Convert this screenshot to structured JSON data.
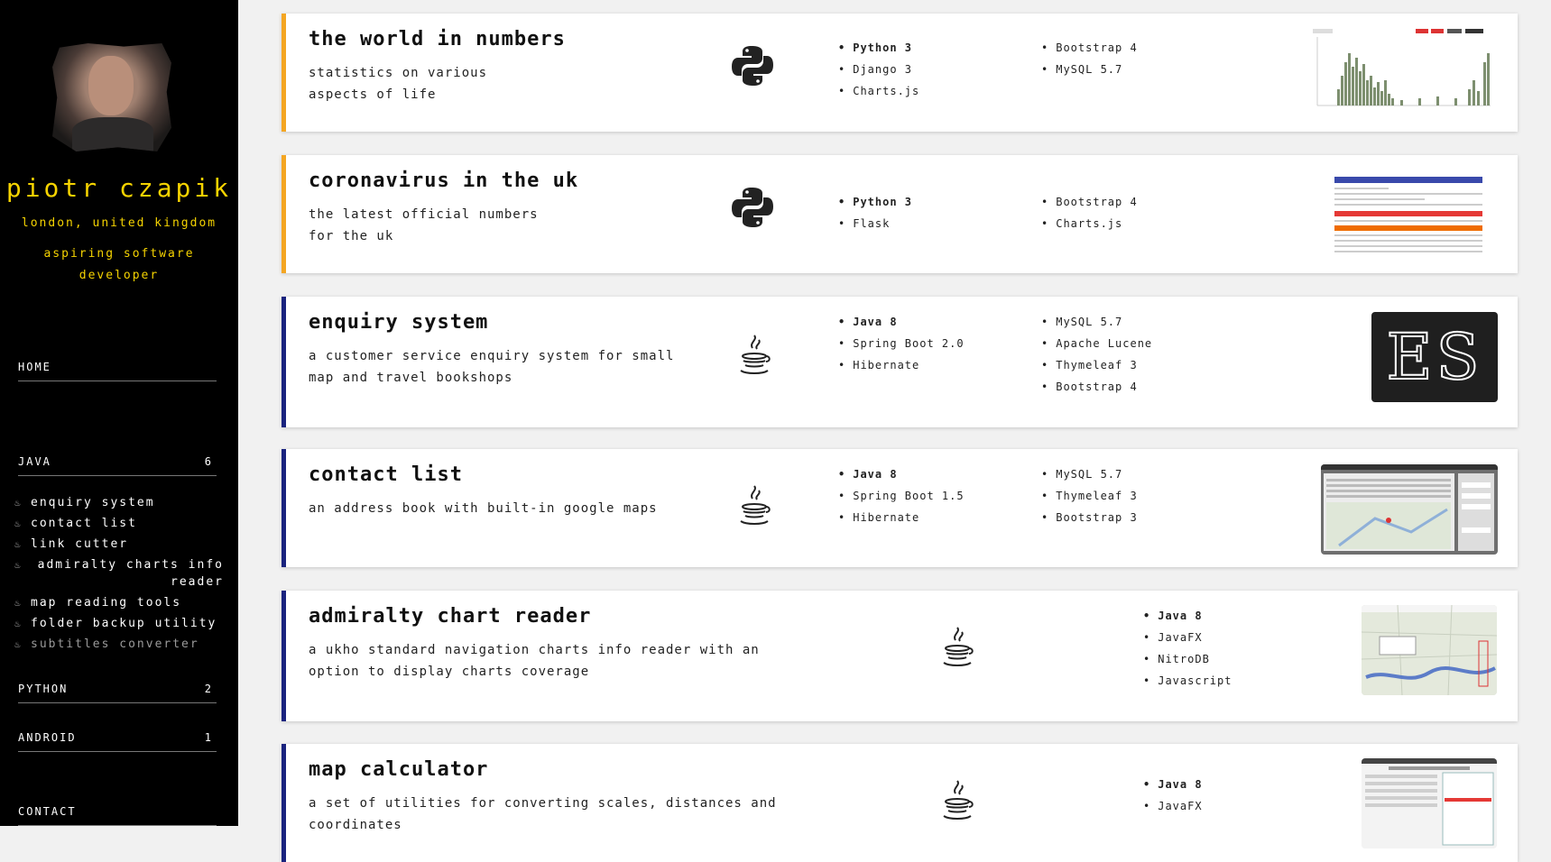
{
  "profile": {
    "name": "piotr czapik",
    "location": "london, united kingdom",
    "role": "aspiring software developer"
  },
  "nav": {
    "home": "HOME",
    "java": {
      "label": "JAVA",
      "count": "6"
    },
    "java_items": [
      "enquiry system",
      "contact list",
      "link cutter",
      "admiralty charts info reader",
      "map reading tools",
      "folder backup utility",
      "subtitles converter"
    ],
    "python": {
      "label": "PYTHON",
      "count": "2"
    },
    "android": {
      "label": "ANDROID",
      "count": "1"
    },
    "contact": "CONTACT"
  },
  "projects": [
    {
      "title": "the world in numbers",
      "desc1": "statistics on various",
      "desc2": "aspects of life",
      "language_icon": "python-icon",
      "tech_a": [
        "Python 3",
        "Django 3",
        "Charts.js"
      ],
      "tech_b": [
        "Bootstrap 4",
        "MySQL 5.7"
      ],
      "thumb": "chart-screenshot"
    },
    {
      "title": "coronavirus in the uk",
      "desc1": "the latest official numbers",
      "desc2": "for the uk",
      "language_icon": "python-icon",
      "tech_a": [
        "Python 3",
        "Flask"
      ],
      "tech_b": [
        "Bootstrap 4",
        "Charts.js"
      ],
      "thumb": "table-screenshot"
    },
    {
      "title": "enquiry system",
      "desc1": "a customer service enquiry system for small",
      "desc2": "map and travel bookshops",
      "language_icon": "java-icon",
      "tech_a": [
        "Java 8",
        "Spring Boot 2.0",
        "Hibernate"
      ],
      "tech_b": [
        "MySQL 5.7",
        "Apache Lucene",
        "Thymeleaf 3",
        "Bootstrap 4"
      ],
      "thumb_text": "ES"
    },
    {
      "title": "contact list",
      "desc1": "an address book with built-in google maps",
      "desc2": "",
      "language_icon": "java-icon",
      "tech_a": [
        "Java 8",
        "Spring Boot 1.5",
        "Hibernate"
      ],
      "tech_b": [
        "MySQL 5.7",
        "Thymeleaf 3",
        "Bootstrap 3"
      ],
      "thumb": "map-app-screenshot"
    },
    {
      "title": "admiralty chart reader",
      "desc1": "a ukho standard navigation charts info reader with an",
      "desc2": "option to display charts coverage",
      "language_icon": "java-icon",
      "tech_a": [
        "Java 8",
        "JavaFX",
        "NitroDB",
        "Javascript"
      ],
      "thumb": "map-screenshot"
    },
    {
      "title": "map calculator",
      "desc1": "a set of utilities for converting scales, distances and",
      "desc2": "coordinates",
      "language_icon": "java-icon",
      "tech_a": [
        "Java 8",
        "JavaFX"
      ],
      "thumb": "calculator-screenshot"
    }
  ],
  "colors": {
    "accent_yellow": "#f5d300",
    "python_border": "#f4a623",
    "java_border": "#1a237e"
  }
}
